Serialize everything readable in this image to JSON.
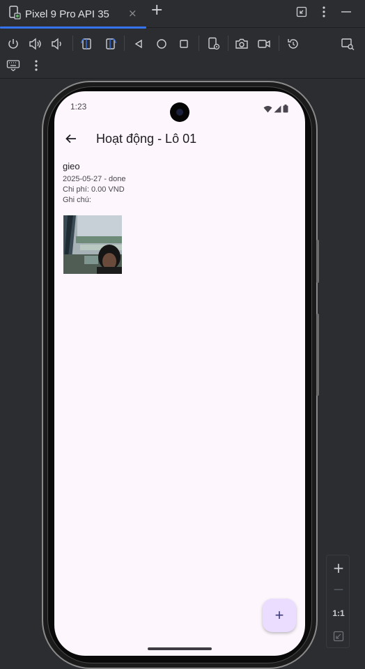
{
  "tool_window": {
    "tab_title": "Pixel 9 Pro API 35",
    "tab_close": "×",
    "add_tab": "+"
  },
  "zoom": {
    "plus": "+",
    "minus": "—",
    "ratio_label": "1:1"
  },
  "phone": {
    "status_bar": {
      "time": "1:23"
    },
    "app_bar": {
      "title": "Hoạt động - Lô 01"
    },
    "activity": {
      "name": "gieo",
      "date_status": "2025-05-27 - done",
      "cost": "Chi phí: 0.00 VND",
      "note": "Ghi chú:"
    },
    "fab_label": "+"
  },
  "colors": {
    "accent": "#3574f0",
    "screen_background": "#fdf7fd",
    "fab_background": "#eaddff"
  }
}
